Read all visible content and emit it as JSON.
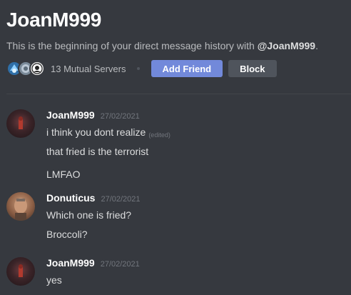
{
  "header": {
    "username": "JoanM999",
    "subtitle_prefix": "This is the beginning of your direct message history with ",
    "subtitle_mention": "@JoanM999",
    "subtitle_suffix": ".",
    "mutual_servers": "13 Mutual Servers",
    "add_friend_label": "Add Friend",
    "block_label": "Block"
  },
  "colors": {
    "background": "#36393f",
    "primary_button": "#7289da",
    "secondary_button": "#4f545c"
  },
  "messages": [
    {
      "author": "JoanM999",
      "timestamp": "27/02/2021",
      "avatar_icon": "user-avatar-joan",
      "lines": [
        {
          "text": "i think you dont realize",
          "edited": "(edited)"
        },
        {
          "text": "that fried is the terrorist"
        },
        {
          "text": "LMFAO"
        }
      ]
    },
    {
      "author": "Donuticus",
      "timestamp": "27/02/2021",
      "avatar_icon": "user-avatar-donuticus",
      "lines": [
        {
          "text": "Which one is fried?"
        },
        {
          "text": "Broccoli?"
        }
      ]
    },
    {
      "author": "JoanM999",
      "timestamp": "27/02/2021",
      "avatar_icon": "user-avatar-joan",
      "lines": [
        {
          "text": "yes"
        }
      ]
    }
  ]
}
